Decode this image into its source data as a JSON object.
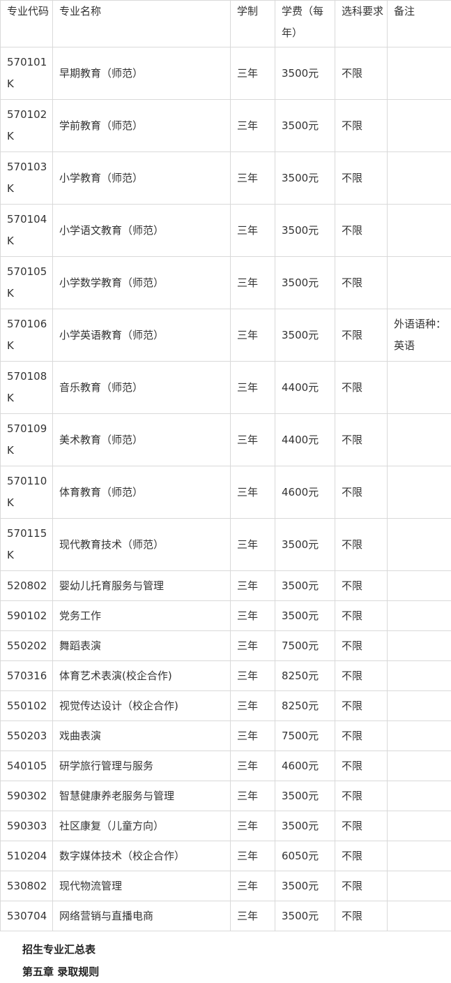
{
  "table": {
    "headers": [
      "专业代码",
      "专业名称",
      "学制",
      "学费（每年）",
      "选科要求",
      "备注"
    ],
    "rows": [
      {
        "code": "570101K",
        "name": "早期教育（师范）",
        "duration": "三年",
        "fee": "3500元",
        "req": "不限",
        "note": ""
      },
      {
        "code": "570102K",
        "name": "学前教育（师范）",
        "duration": "三年",
        "fee": "3500元",
        "req": "不限",
        "note": ""
      },
      {
        "code": "570103K",
        "name": "小学教育（师范）",
        "duration": "三年",
        "fee": "3500元",
        "req": "不限",
        "note": ""
      },
      {
        "code": "570104K",
        "name": "小学语文教育（师范）",
        "duration": "三年",
        "fee": "3500元",
        "req": "不限",
        "note": ""
      },
      {
        "code": "570105K",
        "name": "小学数学教育（师范）",
        "duration": "三年",
        "fee": "3500元",
        "req": "不限",
        "note": ""
      },
      {
        "code": "570106K",
        "name": "小学英语教育（师范）",
        "duration": "三年",
        "fee": "3500元",
        "req": "不限",
        "note": "外语语种：英语"
      },
      {
        "code": "570108K",
        "name": "音乐教育（师范）",
        "duration": "三年",
        "fee": "4400元",
        "req": "不限",
        "note": ""
      },
      {
        "code": "570109K",
        "name": "美术教育（师范）",
        "duration": "三年",
        "fee": "4400元",
        "req": "不限",
        "note": ""
      },
      {
        "code": "570110K",
        "name": "体育教育（师范）",
        "duration": "三年",
        "fee": "4600元",
        "req": "不限",
        "note": ""
      },
      {
        "code": "570115K",
        "name": "现代教育技术（师范）",
        "duration": "三年",
        "fee": "3500元",
        "req": "不限",
        "note": ""
      },
      {
        "code": "520802",
        "name": "婴幼儿托育服务与管理",
        "duration": "三年",
        "fee": "3500元",
        "req": "不限",
        "note": ""
      },
      {
        "code": "590102",
        "name": "党务工作",
        "duration": "三年",
        "fee": "3500元",
        "req": "不限",
        "note": ""
      },
      {
        "code": "550202",
        "name": "舞蹈表演",
        "duration": "三年",
        "fee": "7500元",
        "req": "不限",
        "note": ""
      },
      {
        "code": "570316",
        "name": "体育艺术表演(校企合作)",
        "duration": "三年",
        "fee": "8250元",
        "req": "不限",
        "note": ""
      },
      {
        "code": "550102",
        "name": "视觉传达设计（校企合作)",
        "duration": "三年",
        "fee": "8250元",
        "req": "不限",
        "note": ""
      },
      {
        "code": "550203",
        "name": "戏曲表演",
        "duration": "三年",
        "fee": "7500元",
        "req": "不限",
        "note": ""
      },
      {
        "code": "540105",
        "name": "研学旅行管理与服务",
        "duration": "三年",
        "fee": "4600元",
        "req": "不限",
        "note": ""
      },
      {
        "code": "590302",
        "name": "智慧健康养老服务与管理",
        "duration": "三年",
        "fee": "3500元",
        "req": "不限",
        "note": ""
      },
      {
        "code": "590303",
        "name": "社区康复（儿童方向）",
        "duration": "三年",
        "fee": "3500元",
        "req": "不限",
        "note": ""
      },
      {
        "code": "510204",
        "name": "数字媒体技术（校企合作）",
        "duration": "三年",
        "fee": "6050元",
        "req": "不限",
        "note": ""
      },
      {
        "code": "530802",
        "name": "现代物流管理",
        "duration": "三年",
        "fee": "3500元",
        "req": "不限",
        "note": ""
      },
      {
        "code": "530704",
        "name": "网络营销与直播电商",
        "duration": "三年",
        "fee": "3500元",
        "req": "不限",
        "note": ""
      }
    ]
  },
  "footer": {
    "caption": "招生专业汇总表",
    "chapter": "第五章  录取规则"
  }
}
